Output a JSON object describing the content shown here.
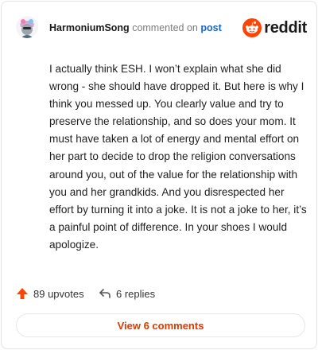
{
  "header": {
    "username": "HarmoniumSong",
    "action_text": "commented on",
    "post_link": "post"
  },
  "brand": {
    "wordmark": "reddit",
    "icon": "reddit-snoo-icon",
    "accent_color": "#ff4500"
  },
  "comment": {
    "body": "I actually think ESH. I won’t explain what she did wrong - she should have dropped it. But here is why I think you messed up. You clearly value and try to preserve the relationship, and so does your mom. It must have taken a lot of energy and mental effort on her part to decide to drop the religion conversations around you, out of the value for the relationship with you and her grandkids. And you disrespected her effort by turning it into a joke. It is not a joke to her, it’s a painful point of difference. In your shoes I would apologize."
  },
  "stats": {
    "upvotes_label": "89 upvotes",
    "upvote_icon": "upvote-arrow-icon",
    "replies_label": "6 replies",
    "reply_icon": "reply-arrow-icon"
  },
  "actions": {
    "view_comments_label": "View 6 comments"
  }
}
